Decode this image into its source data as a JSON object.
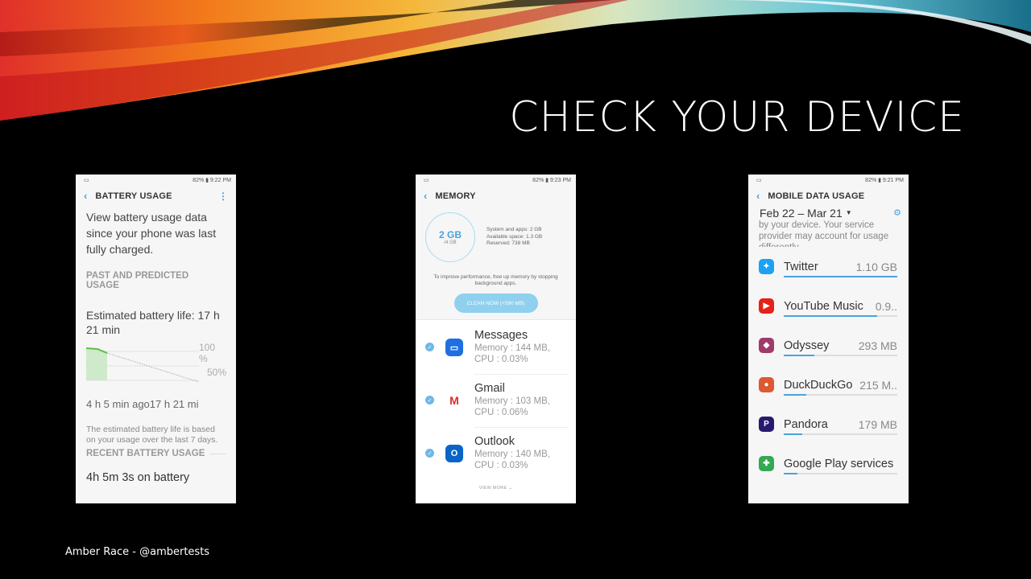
{
  "slide": {
    "title": "CHECK YOUR DEVICE",
    "footer": "Amber Race - @ambertests"
  },
  "battery": {
    "status_time": "82% ▮ 9:22 PM",
    "header": "BATTERY USAGE",
    "intro": "View battery usage data since your phone was last fully charged.",
    "section1": "PAST AND PREDICTED USAGE",
    "estimate": "Estimated battery life: 17 h 21 min",
    "label_100": "100 %",
    "label_50": "50%",
    "time_left": "4 h 5 min ago",
    "time_right": "17 h 21 mi",
    "note": "The estimated battery life is based on your usage over the last 7 days.",
    "section2": "RECENT BATTERY USAGE",
    "on_battery": "4h 5m 3s on battery"
  },
  "memory": {
    "status_time": "82% ▮ 9:23 PM",
    "header": "MEMORY",
    "used": "2 GB",
    "total": "/4 GB",
    "info": [
      "System and apps: 2 GB",
      "Available space: 1.3 GB",
      "Reserved: 738 MB"
    ],
    "tip": "To improve performance, free up memory by stopping background apps.",
    "clean_button": "CLEAN NOW (+590 MB)",
    "apps": [
      {
        "name": "Messages",
        "memory": "Memory : 144 MB,",
        "cpu": "CPU : 0.03%",
        "color": "#1e6fe0",
        "icon": "chat-icon"
      },
      {
        "name": "Gmail",
        "memory": "Memory : 103 MB,",
        "cpu": "CPU : 0.06%",
        "color": "#ffffff",
        "icon": "gmail-icon"
      },
      {
        "name": "Outlook",
        "memory": "Memory : 140 MB,",
        "cpu": "CPU : 0.03%",
        "color": "#0a64c8",
        "icon": "outlook-icon"
      }
    ],
    "view_more": "VIEW MORE"
  },
  "data": {
    "status_time": "82% ▮ 9:21 PM",
    "header": "MOBILE DATA USAGE",
    "range": "Feb 22 – Mar 21",
    "note": "by your device. Your service provider may account for usage differently.",
    "apps": [
      {
        "name": "Twitter",
        "value": "1.10 GB",
        "usage": 1.0,
        "color": "#1da1f2",
        "icon": "twitter-icon"
      },
      {
        "name": "YouTube Music",
        "value": "0.9..",
        "usage": 0.82,
        "color": "#e62117",
        "icon": "youtube-music-icon"
      },
      {
        "name": "Odyssey",
        "value": "293 MB",
        "usage": 0.27,
        "color": "#a03a6a",
        "icon": "odyssey-icon"
      },
      {
        "name": "DuckDuckGo",
        "value": "215 M..",
        "usage": 0.2,
        "color": "#de5833",
        "icon": "duckduckgo-icon"
      },
      {
        "name": "Pandora",
        "value": "179 MB",
        "usage": 0.16,
        "color": "#2a1a6e",
        "icon": "pandora-icon"
      },
      {
        "name": "Google Play services",
        "value": "",
        "usage": 0.12,
        "color": "#34a853",
        "icon": "play-services-icon"
      }
    ]
  }
}
